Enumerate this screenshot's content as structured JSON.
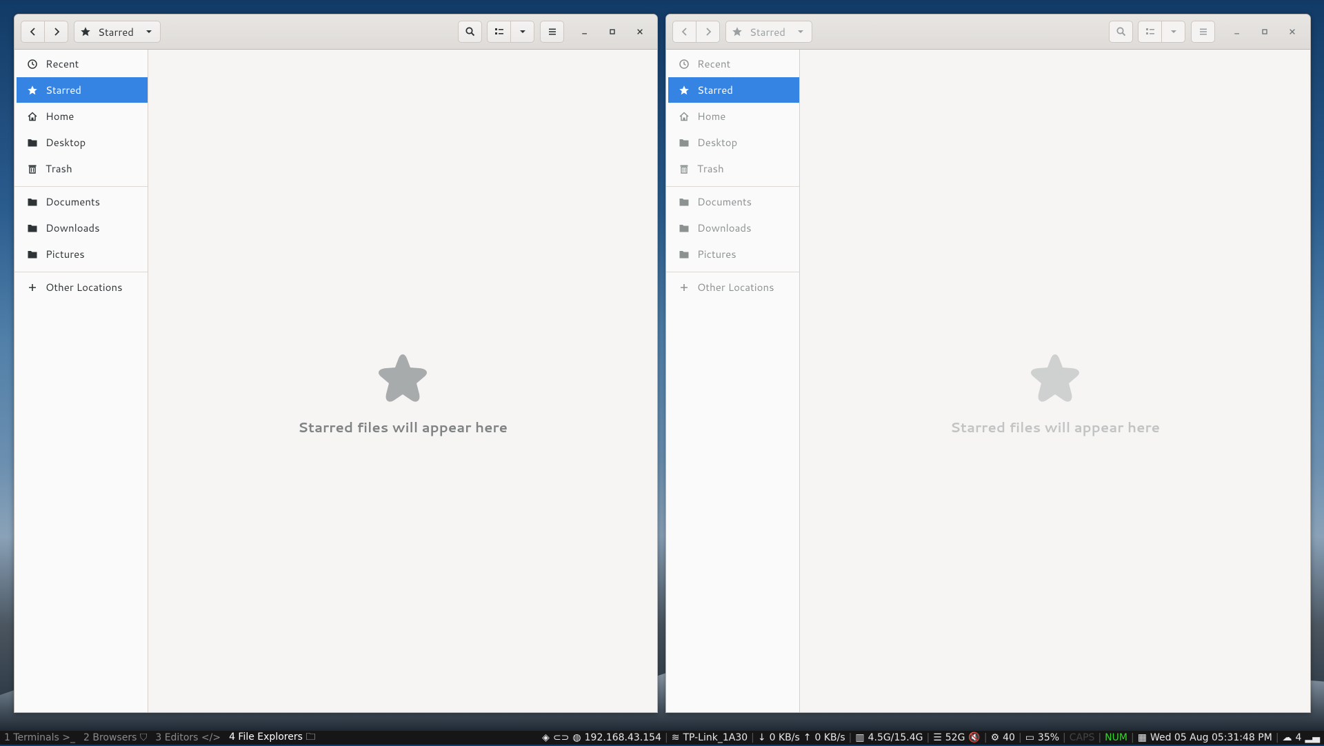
{
  "left_window": {
    "location": "Starred",
    "sidebar": [
      {
        "label": "Recent",
        "icon": "clock-icon"
      },
      {
        "label": "Starred",
        "icon": "star-icon"
      },
      {
        "label": "Home",
        "icon": "home-icon"
      },
      {
        "label": "Desktop",
        "icon": "folder-icon"
      },
      {
        "label": "Trash",
        "icon": "trash-icon"
      },
      {
        "label": "Documents",
        "icon": "folder-icon"
      },
      {
        "label": "Downloads",
        "icon": "folder-icon"
      },
      {
        "label": "Pictures",
        "icon": "folder-icon"
      },
      {
        "label": "Other Locations",
        "icon": "plus-icon"
      }
    ],
    "empty_message": "Starred files will appear here"
  },
  "right_window": {
    "location": "Starred",
    "sidebar": [
      {
        "label": "Recent",
        "icon": "clock-icon"
      },
      {
        "label": "Starred",
        "icon": "star-icon"
      },
      {
        "label": "Home",
        "icon": "home-icon"
      },
      {
        "label": "Desktop",
        "icon": "folder-icon"
      },
      {
        "label": "Trash",
        "icon": "trash-icon"
      },
      {
        "label": "Documents",
        "icon": "folder-icon"
      },
      {
        "label": "Downloads",
        "icon": "folder-icon"
      },
      {
        "label": "Pictures",
        "icon": "folder-icon"
      },
      {
        "label": "Other Locations",
        "icon": "plus-icon"
      }
    ],
    "empty_message": "Starred files will appear here"
  },
  "colors": {
    "accent": "#3584e4",
    "panel_bg": "#161616",
    "num_indicator": "#38d430"
  },
  "panel": {
    "workspaces": [
      {
        "label": "1 Terminals >_"
      },
      {
        "label": "2 Browsers"
      },
      {
        "label": "3 Editors </>"
      },
      {
        "label": "4 File Explorers"
      }
    ],
    "ip": "192.168.43.154",
    "wifi": "TP-Link_1A30",
    "download": "0 KB/s",
    "upload": "0 KB/s",
    "memory": "4.5G/15.4G",
    "disk": "52G",
    "temperature": "40",
    "battery": "35%",
    "caps": "CAPS",
    "num": "NUM",
    "datetime": "Wed 05 Aug 05:31:48 PM",
    "notifications": "4"
  }
}
